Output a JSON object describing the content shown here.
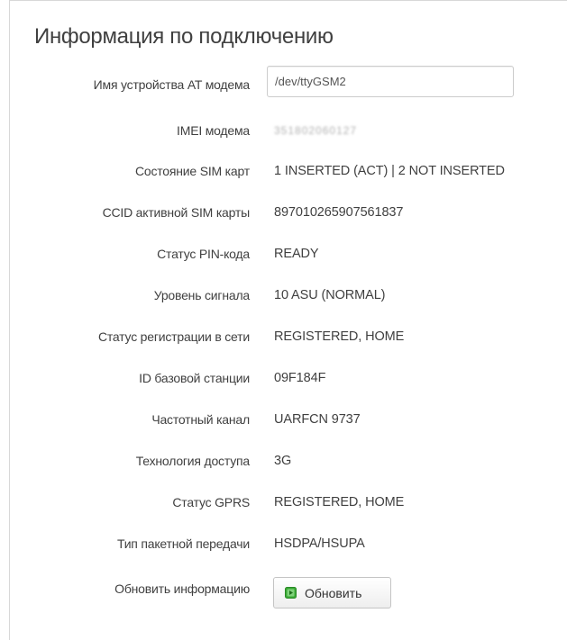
{
  "section": {
    "title": "Информация по подключению"
  },
  "device": {
    "label": "Имя устройства AT модема",
    "value": "/dev/ttyGSM2"
  },
  "rows": [
    {
      "label": "IMEI модема",
      "value": "351802060127"
    },
    {
      "label": "Состояние SIM карт",
      "value": "1 INSERTED (ACT) | 2 NOT INSERTED"
    },
    {
      "label": "CCID активной SIM карты",
      "value": "897010265907561837"
    },
    {
      "label": "Статус PIN-кода",
      "value": "READY"
    },
    {
      "label": "Уровень сигнала",
      "value": "10 ASU (NORMAL)"
    },
    {
      "label": "Статус регистрации в сети",
      "value": "REGISTERED, HOME"
    },
    {
      "label": "ID базовой станции",
      "value": "09F184F"
    },
    {
      "label": "Частотный канал",
      "value": "UARFCN 9737"
    },
    {
      "label": "Технология доступа",
      "value": "3G"
    },
    {
      "label": "Статус GPRS",
      "value": "REGISTERED, HOME"
    },
    {
      "label": "Тип пакетной передачи",
      "value": "HSDPA/HSUPA"
    }
  ],
  "refresh": {
    "label": "Обновить информацию",
    "button_label": "Обновить",
    "icon": "refresh-icon"
  },
  "colors": {
    "text": "#404040",
    "button_icon_green": "#3aa935",
    "border": "#d8d8d8"
  }
}
